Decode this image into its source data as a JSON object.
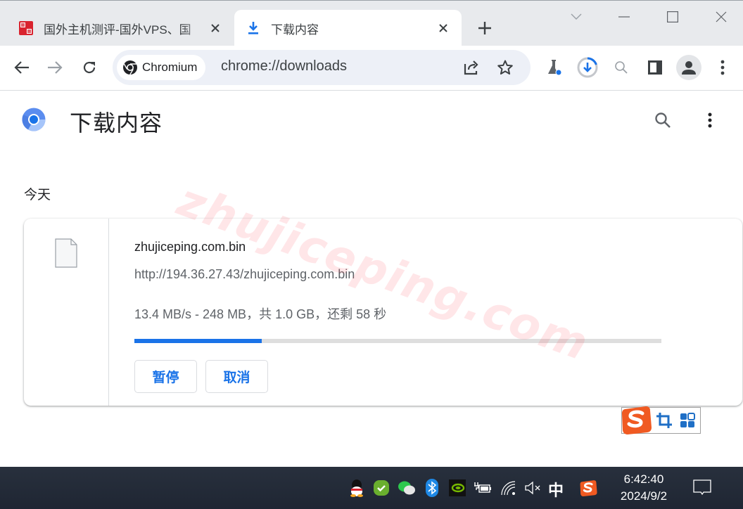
{
  "browser": {
    "tabs": [
      {
        "title": "国外主机测评-国外VPS、国",
        "favicon": "site-seal-icon",
        "active": false
      },
      {
        "title": "下载内容",
        "favicon": "download-icon",
        "active": true
      }
    ],
    "window_controls": [
      "tab-search",
      "minimize",
      "maximize",
      "close"
    ],
    "nav": {
      "back": "back-arrow-icon",
      "forward": "forward-arrow-icon",
      "reload": "reload-icon"
    },
    "omnibox": {
      "chip_label": "Chromium",
      "url": "chrome://downloads"
    },
    "toolbar_icons": [
      "share-icon",
      "bookmark-star-icon",
      "labs-flask-icon",
      "download-progress-icon",
      "zoom-icon",
      "side-panel-icon",
      "profile-avatar-icon",
      "menu-kebab-icon"
    ]
  },
  "page": {
    "title": "下载内容",
    "section_label": "今天",
    "download": {
      "file_name": "zhujiceping.com.bin",
      "url": "http://194.36.27.43/zhujiceping.com.bin",
      "status": "13.4 MB/s - 248 MB，共 1.0 GB，还剩 58 秒",
      "progress_percent": 24.2,
      "pause_label": "暂停",
      "cancel_label": "取消"
    },
    "watermark": "zhujiceping.com"
  },
  "taskbar": {
    "tray_icons": [
      "qq-icon",
      "security-shield-icon",
      "wechat-icon",
      "bluetooth-icon",
      "nvidia-icon",
      "battery-charging-icon",
      "wifi-icon",
      "volume-muted-icon"
    ],
    "ime_indicator": "中",
    "time": "6:42:40",
    "date": "2024/9/2"
  },
  "colors": {
    "accent": "#1a73e8",
    "tabstrip": "#e8eaed",
    "omnibox": "#edf0f7",
    "taskbar": "#222a37",
    "sogou": "#f05a22"
  }
}
